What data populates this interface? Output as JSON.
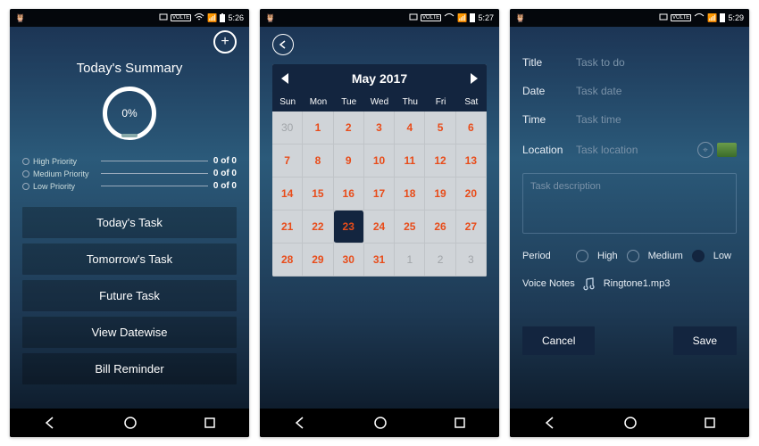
{
  "status": {
    "time1": "5:26",
    "time2": "5:27",
    "time3": "5:29",
    "volte": "VOLTE"
  },
  "screen1": {
    "title": "Today's Summary",
    "percent": "0%",
    "priorities": [
      {
        "label": "High Priority",
        "count": "0 of 0"
      },
      {
        "label": "Medium Priority",
        "count": "0 of 0"
      },
      {
        "label": "Low Priority",
        "count": "0 of 0"
      }
    ],
    "buttons": [
      "Today's Task",
      "Tomorrow's Task",
      "Future Task",
      "View Datewise",
      "Bill Reminder"
    ]
  },
  "screen2": {
    "month": "May 2017",
    "weekdays": [
      "Sun",
      "Mon",
      "Tue",
      "Wed",
      "Thu",
      "Fri",
      "Sat"
    ],
    "days": [
      {
        "n": "30",
        "o": true
      },
      {
        "n": "1"
      },
      {
        "n": "2"
      },
      {
        "n": "3"
      },
      {
        "n": "4"
      },
      {
        "n": "5"
      },
      {
        "n": "6"
      },
      {
        "n": "7"
      },
      {
        "n": "8"
      },
      {
        "n": "9"
      },
      {
        "n": "10"
      },
      {
        "n": "11"
      },
      {
        "n": "12"
      },
      {
        "n": "13"
      },
      {
        "n": "14"
      },
      {
        "n": "15"
      },
      {
        "n": "16"
      },
      {
        "n": "17"
      },
      {
        "n": "18"
      },
      {
        "n": "19"
      },
      {
        "n": "20"
      },
      {
        "n": "21"
      },
      {
        "n": "22"
      },
      {
        "n": "23",
        "sel": true
      },
      {
        "n": "24"
      },
      {
        "n": "25"
      },
      {
        "n": "26"
      },
      {
        "n": "27"
      },
      {
        "n": "28"
      },
      {
        "n": "29"
      },
      {
        "n": "30"
      },
      {
        "n": "31"
      },
      {
        "n": "1",
        "o": true
      },
      {
        "n": "2",
        "o": true
      },
      {
        "n": "3",
        "o": true
      }
    ]
  },
  "screen3": {
    "fields": {
      "title_label": "Title",
      "title_ph": "Task to do",
      "date_label": "Date",
      "date_ph": "Task date",
      "time_label": "Time",
      "time_ph": "Task time",
      "location_label": "Location",
      "location_ph": "Task location",
      "desc_ph": "Task description"
    },
    "period_label": "Period",
    "period_options": [
      "High",
      "Medium",
      "Low"
    ],
    "period_selected": "Low",
    "voice_label": "Voice Notes",
    "voice_file": "Ringtone1.mp3",
    "cancel": "Cancel",
    "save": "Save"
  }
}
